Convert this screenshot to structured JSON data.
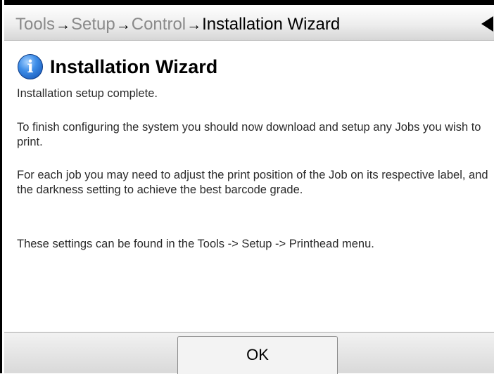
{
  "header": {
    "breadcrumb": [
      "Tools",
      "Setup",
      "Control"
    ],
    "current": "Installation Wizard",
    "separator": "→",
    "back_icon": "back-triangle-icon"
  },
  "dialog": {
    "icon": "info-icon",
    "icon_glyph": "i",
    "title": "Installation Wizard",
    "paragraphs": [
      "Installation setup complete.",
      "To finish configuring the system you should now download and setup any Jobs you wish to print.",
      "For each job you may need to adjust the print position of the Job on its respective label, and the darkness setting to achieve the best barcode grade.",
      "These settings can be found in the Tools -> Setup -> Printhead menu."
    ]
  },
  "footer": {
    "ok_label": "OK"
  },
  "colors": {
    "breadcrumb_inactive": "#8a8a8a",
    "text": "#2a2a2a",
    "info_icon_blue": "#3f8ee8"
  }
}
